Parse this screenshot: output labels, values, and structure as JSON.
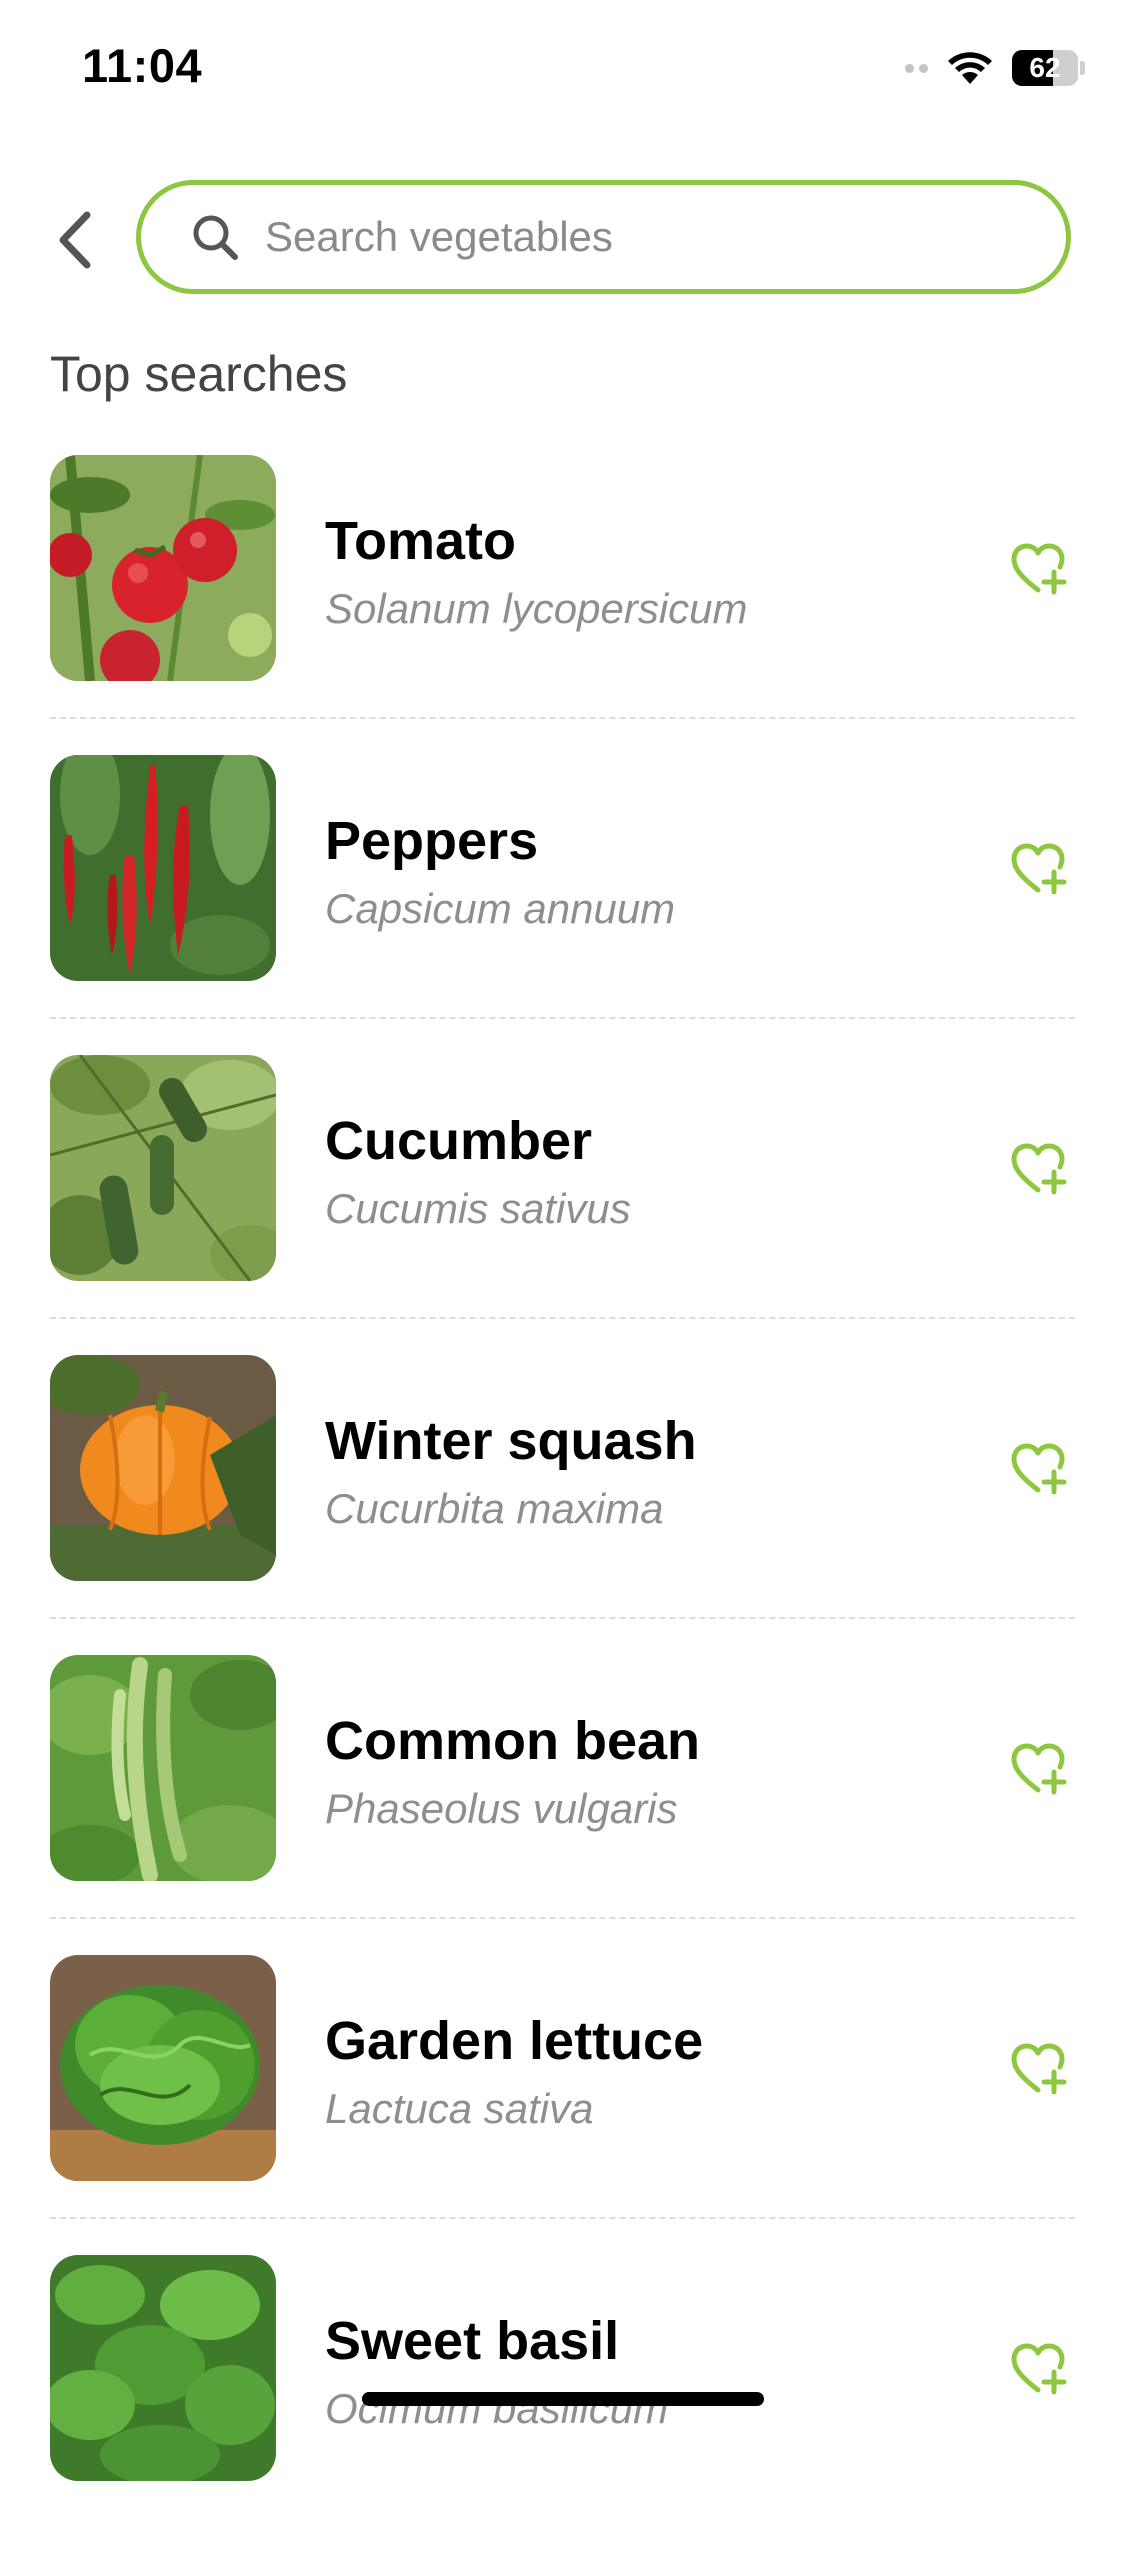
{
  "status_bar": {
    "time": "11:04",
    "battery": "62",
    "battery_level": 0.62
  },
  "search": {
    "placeholder": "Search vegetables",
    "value": "",
    "accent_color": "#8dc63f"
  },
  "section_title": "Top searches",
  "items": [
    {
      "name": "Tomato",
      "latin": "Solanum lycopersicum"
    },
    {
      "name": "Peppers",
      "latin": "Capsicum annuum"
    },
    {
      "name": "Cucumber",
      "latin": "Cucumis sativus"
    },
    {
      "name": "Winter squash",
      "latin": "Cucurbita maxima"
    },
    {
      "name": "Common bean",
      "latin": "Phaseolus vulgaris"
    },
    {
      "name": "Garden lettuce",
      "latin": "Lactuca sativa"
    },
    {
      "name": "Sweet basil",
      "latin": "Ocimum basilicum"
    }
  ],
  "icons": {
    "back": "chevron-left-icon",
    "search": "search-icon",
    "favorite": "heart-plus-icon"
  }
}
